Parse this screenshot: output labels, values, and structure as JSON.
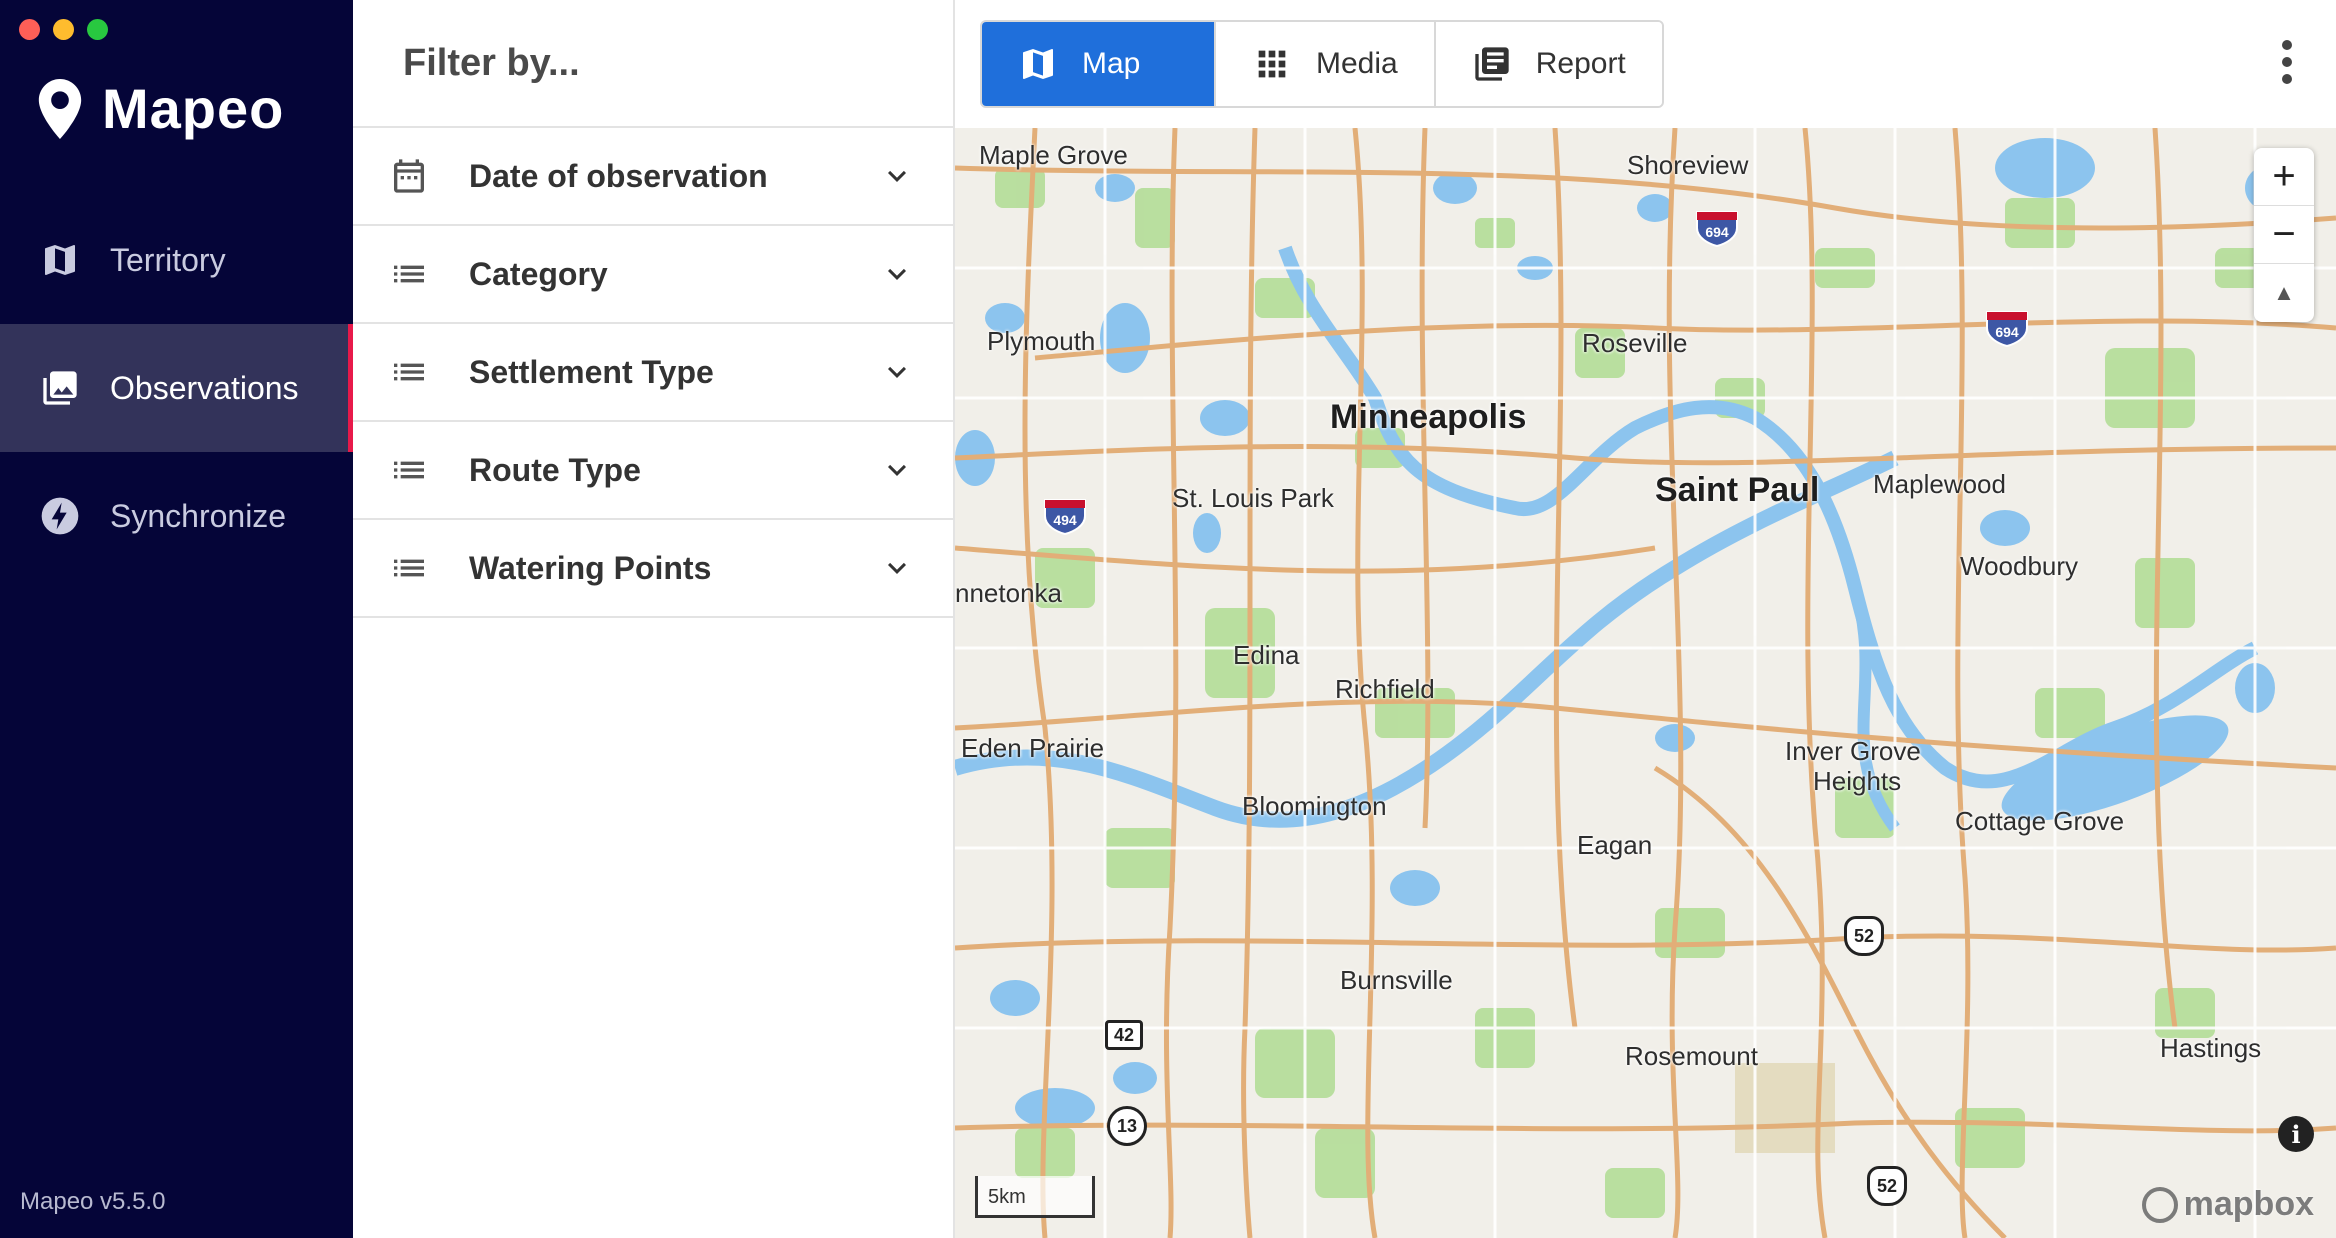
{
  "window": {
    "controls": [
      "close",
      "minimize",
      "maximize"
    ]
  },
  "brand": {
    "name": "Mapeo",
    "icon": "map-pin-icon"
  },
  "nav": {
    "items": [
      {
        "label": "Territory",
        "icon": "map-icon",
        "active": false
      },
      {
        "label": "Observations",
        "icon": "photo-library-icon",
        "active": true
      },
      {
        "label": "Synchronize",
        "icon": "bolt-icon",
        "active": false
      }
    ]
  },
  "version": "Mapeo v5.5.0",
  "filter": {
    "title": "Filter by...",
    "rows": [
      {
        "label": "Date of observation",
        "icon": "calendar-icon"
      },
      {
        "label": "Category",
        "icon": "list-icon"
      },
      {
        "label": "Settlement Type",
        "icon": "list-icon"
      },
      {
        "label": "Route Type",
        "icon": "list-icon"
      },
      {
        "label": "Watering Points",
        "icon": "list-icon"
      }
    ]
  },
  "toolbar": {
    "map_label": "Map",
    "media_label": "Media",
    "report_label": "Report",
    "active": "Map"
  },
  "map": {
    "places": {
      "maple_grove": "Maple Grove",
      "shoreview": "Shoreview",
      "plymouth": "Plymouth",
      "roseville": "Roseville",
      "minneapolis": "Minneapolis",
      "saint_paul": "Saint Paul",
      "maplewood": "Maplewood",
      "st_louis_park": "St. Louis Park",
      "woodbury": "Woodbury",
      "minnetonka": "nnetonka",
      "edina": "Edina",
      "richfield": "Richfield",
      "eden_prairie": "Eden Prairie",
      "inver_grove": "Inver Grove",
      "heights": "Heights",
      "bloomington": "Bloomington",
      "cottage_grove": "Cottage Grove",
      "eagan": "Eagan",
      "burnsville": "Burnsville",
      "rosemount": "Rosemount",
      "hastings": "Hastings"
    },
    "shields": {
      "i694_a": "694",
      "i694_b": "694",
      "i494": "494",
      "us52_a": "52",
      "us52_b": "52",
      "r42": "42",
      "r13": "13"
    },
    "zoom_in": "+",
    "zoom_out": "−",
    "compass": "▲",
    "scale": "5km",
    "info": "i",
    "attribution": "mapbox",
    "colors": {
      "water": "#8cc4ee",
      "park": "#a8d88b",
      "road": "#e0a970",
      "land": "#f1efe9"
    }
  },
  "colors": {
    "sidebar": "#050538",
    "active_nav": "#33335a",
    "accent": "#e8194a",
    "primary": "#1f6fdb"
  }
}
